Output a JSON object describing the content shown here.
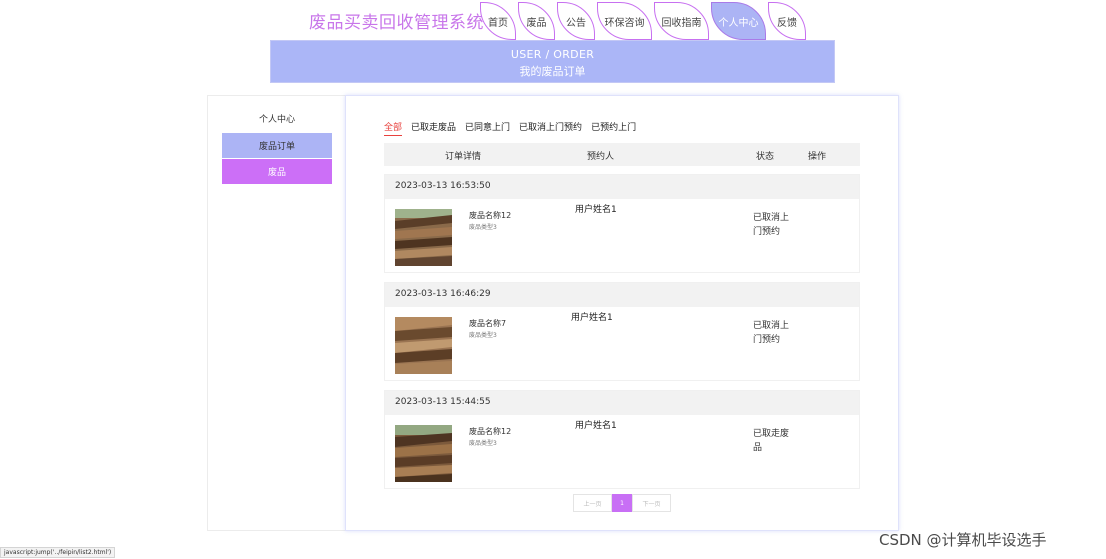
{
  "site": {
    "title": "废品买卖回收管理系统"
  },
  "nav": {
    "items": [
      {
        "label": "首页"
      },
      {
        "label": "废品"
      },
      {
        "label": "公告"
      },
      {
        "label": "环保咨询"
      },
      {
        "label": "回收指南"
      },
      {
        "label": "个人中心",
        "active": true
      },
      {
        "label": "反馈"
      }
    ]
  },
  "banner": {
    "en": "USER / ORDER",
    "cn": "我的废品订单"
  },
  "sidebar": {
    "heading": "个人中心",
    "items": [
      {
        "label": "废品订单"
      },
      {
        "label": "废品"
      }
    ]
  },
  "tabs": [
    {
      "label": "全部",
      "active": true
    },
    {
      "label": "已取走废品"
    },
    {
      "label": "已同意上门"
    },
    {
      "label": "已取消上门预约"
    },
    {
      "label": "已预约上门"
    }
  ],
  "table": {
    "headers": [
      "订单详情",
      "预约人",
      "状态",
      "操作"
    ]
  },
  "orders": [
    {
      "time": "2023-03-13 16:53:50",
      "name": "废品名称12",
      "type": "废品类型3",
      "booker": "用户姓名1",
      "status": "已取消上门预约"
    },
    {
      "time": "2023-03-13 16:46:29",
      "name": "废品名称7",
      "type": "废品类型3",
      "booker": "用户姓名1",
      "status": "已取消上门预约"
    },
    {
      "time": "2023-03-13 15:44:55",
      "name": "废品名称12",
      "type": "废品类型3",
      "booker": "用户姓名1",
      "status": "已取走废品"
    }
  ],
  "pager": {
    "prev": "上一页",
    "current": "1",
    "next": "下一页"
  },
  "statusbar": {
    "text": "javascript:jump('../feipin/list2.html')"
  },
  "watermark": {
    "text": "CSDN @计算机毕设选手"
  },
  "colors": {
    "accent": "#c876ea",
    "nav_active": "#acb4f5",
    "tab_active": "#e8413d"
  }
}
